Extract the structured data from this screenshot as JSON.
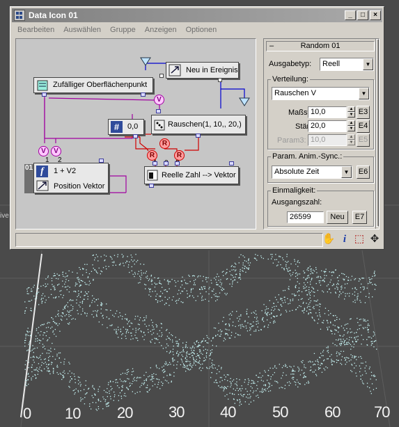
{
  "window": {
    "title": "Data Icon 01",
    "controls": {
      "minimize": "_",
      "maximize": "□",
      "close": "×"
    }
  },
  "menu": [
    "Bearbeiten",
    "Auswählen",
    "Gruppe",
    "Anzeigen",
    "Optionen"
  ],
  "graph": {
    "nodes": {
      "surface_point": "Zufälliger Oberflächenpunkt",
      "new_event": "Neu in Ereignis",
      "constant": "0,0",
      "noise": "Rauschen(1, 10,, 20,)",
      "function_index": "01",
      "function_expr": "1 + V2",
      "function_out": "Position Vektor",
      "real_to_vector": "Reelle Zahl --> Vektor"
    },
    "port_letters": {
      "v": "V",
      "r": "R"
    },
    "port_numbers": {
      "f1": "1",
      "f2": "2",
      "c1": "1",
      "c2": "2",
      "c3": "3"
    }
  },
  "panel": {
    "rollout_minus": "–",
    "rollout_title": "Random 01",
    "ausgabetyp_label": "Ausgabetyp:",
    "ausgabetyp_value": "Reell",
    "verteilung_title": "Verteilung:",
    "verteilung_value": "Rauschen V",
    "massstab_label": "Maßstab:",
    "massstab_value": "10,0",
    "massstab_btn": "E3",
    "staerke_label": "Stärke:",
    "staerke_value": "20,0",
    "staerke_btn": "E4",
    "param3_label": "Param3:",
    "param3_value": "10,0",
    "param3_btn": "E5",
    "sync_title": "Param. Anim.-Sync.:",
    "sync_value": "Absolute Zeit",
    "sync_btn": "E6",
    "uniqueness_title": "Einmaligkeit:",
    "seed_label": "Ausgangszahl:",
    "seed_value": "26599",
    "new_btn": "Neu",
    "seed_btn": "E7",
    "combo_arrow": "▼",
    "spin_up": "▲",
    "spin_down": "▼"
  },
  "status_icons": [
    "hand-icon",
    "info-icon",
    "region-select-icon",
    "move-icon"
  ],
  "status_glyphs": {
    "hand": "✋",
    "info": "i",
    "region": "⬚",
    "move": "✥"
  },
  "viewport": {
    "label": "ive",
    "axis_numbers": [
      "0",
      "10",
      "20",
      "30",
      "40",
      "50",
      "60",
      "70"
    ]
  },
  "colors": {
    "particles": "#c8f6f6",
    "viewport_bg": "#4a4a4a",
    "link_magenta": "#a000a0",
    "link_red": "#d00000",
    "link_blue": "#0000d0"
  }
}
